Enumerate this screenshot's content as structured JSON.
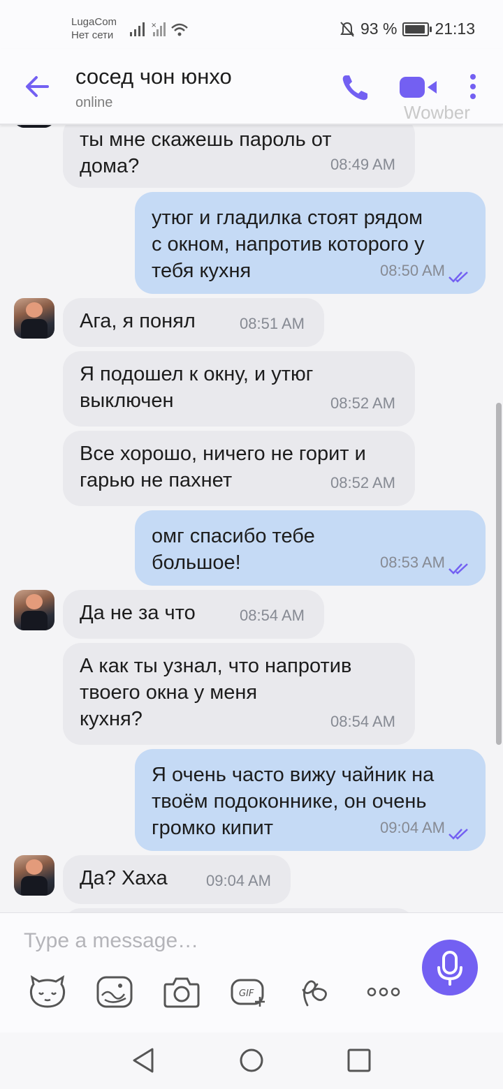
{
  "status_bar": {
    "carrier": "LugaCom",
    "network": "Нет сети",
    "battery": "93 %",
    "battery_level": 0.93,
    "time": "21:13"
  },
  "header": {
    "contact_name": "сосед чон юнхо",
    "status": "online",
    "watermark": "Wowber"
  },
  "messages": [
    {
      "dir": "in",
      "text": "ты мне скажешь пароль от\nдома?",
      "time": "08:49 AM"
    },
    {
      "dir": "out",
      "text": "утюг и гладилка стоят рядом\nс окном, напротив которого у\nтебя кухня",
      "time": "08:50 AM"
    },
    {
      "dir": "in",
      "text": "Ага, я понял",
      "time": "08:51 AM"
    },
    {
      "dir": "in",
      "text": "Я подошел к окну, и утюг\nвыключен",
      "time": "08:52 AM"
    },
    {
      "dir": "in",
      "text": "Все хорошо, ничего не горит и\nгарью не пахнет",
      "time": "08:52 AM"
    },
    {
      "dir": "out",
      "text": "омг спасибо тебе\nбольшое!",
      "time": "08:53 AM"
    },
    {
      "dir": "in",
      "text": "Да не за что",
      "time": "08:54 AM"
    },
    {
      "dir": "in",
      "text": "А как ты узнал, что напротив\nтвоего окна у меня\nкухня?",
      "time": "08:54 AM"
    },
    {
      "dir": "out",
      "text": "Я очень часто вижу чайник на\nтвоём подоконнике, он очень\nгромко кипит",
      "time": "09:04 AM"
    },
    {
      "dir": "in",
      "text": "Да? Хаха",
      "time": "09:04 AM"
    }
  ],
  "composer": {
    "placeholder": "Type a message…",
    "tools": [
      "sticker-icon",
      "doodle-icon",
      "camera-icon",
      "gif-icon",
      "chat-extensions-icon",
      "more-options-icon"
    ]
  },
  "colors": {
    "accent": "#7360f2",
    "incoming_bubble": "#e9e9ed",
    "outgoing_bubble": "#c5daf5",
    "chat_background": "#f4f4f6"
  }
}
